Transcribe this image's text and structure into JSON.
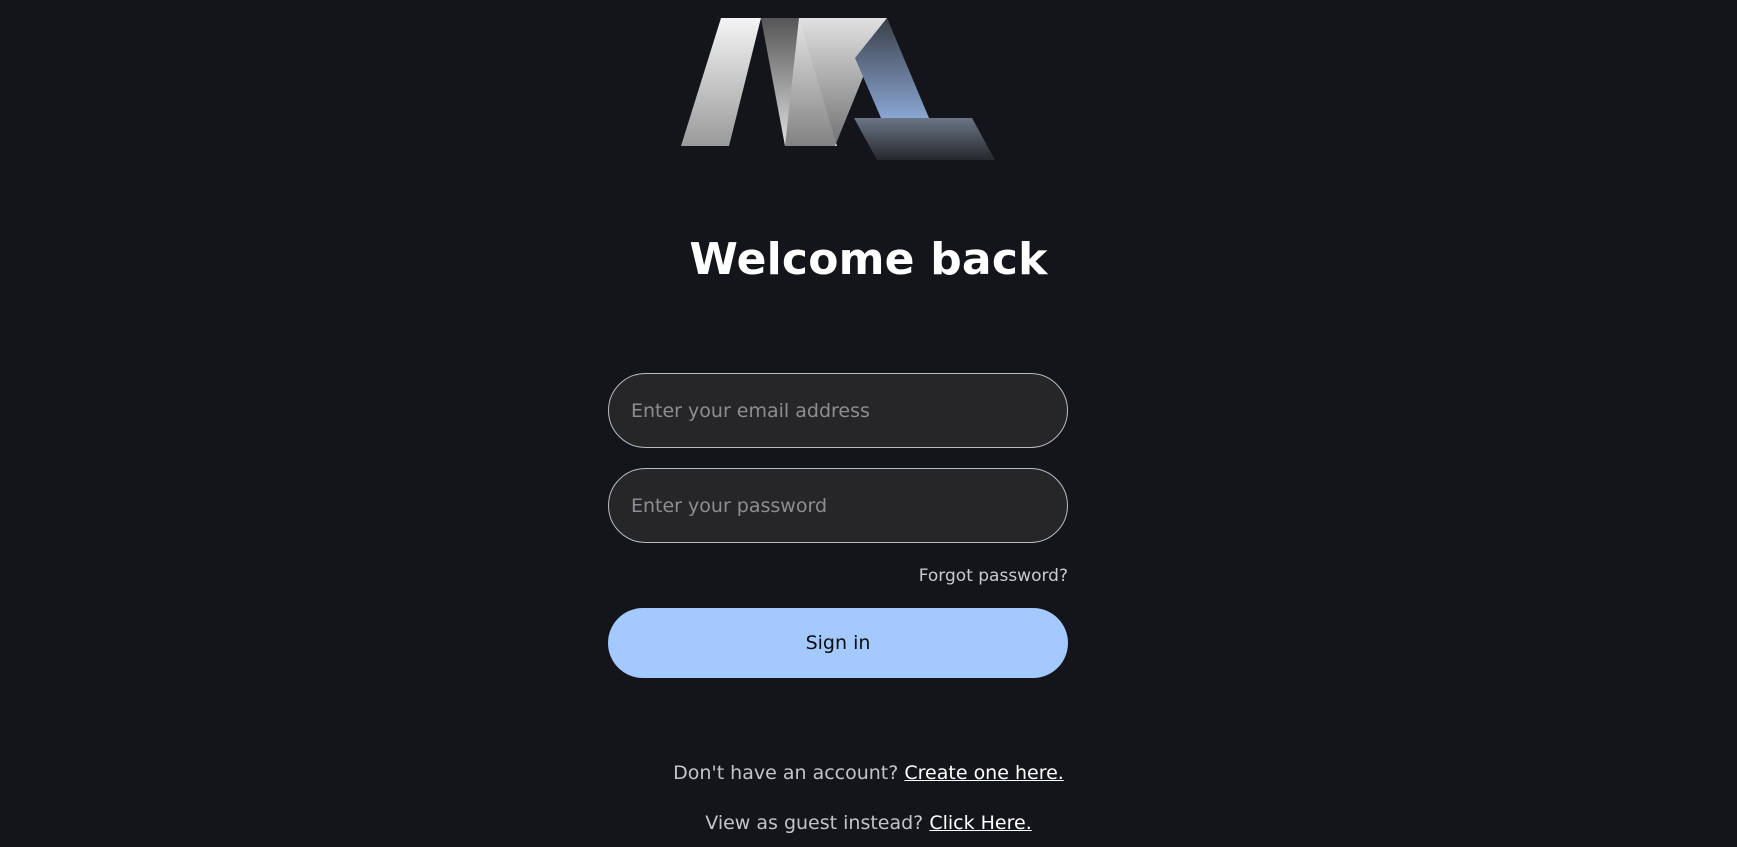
{
  "heading": "Welcome back",
  "form": {
    "email_placeholder": "Enter your email address",
    "password_placeholder": "Enter your password",
    "forgot_label": "Forgot password?",
    "submit_label": "Sign in"
  },
  "footer": {
    "signup_prompt": "Don't have an account?",
    "signup_link": "Create one here.",
    "guest_prompt": "View as guest instead?",
    "guest_link": "Click Here."
  },
  "colors": {
    "background": "#14151a",
    "accent": "#a3c9ff",
    "field_background": "#262628"
  },
  "icons": {
    "logo": "brand-logo"
  }
}
